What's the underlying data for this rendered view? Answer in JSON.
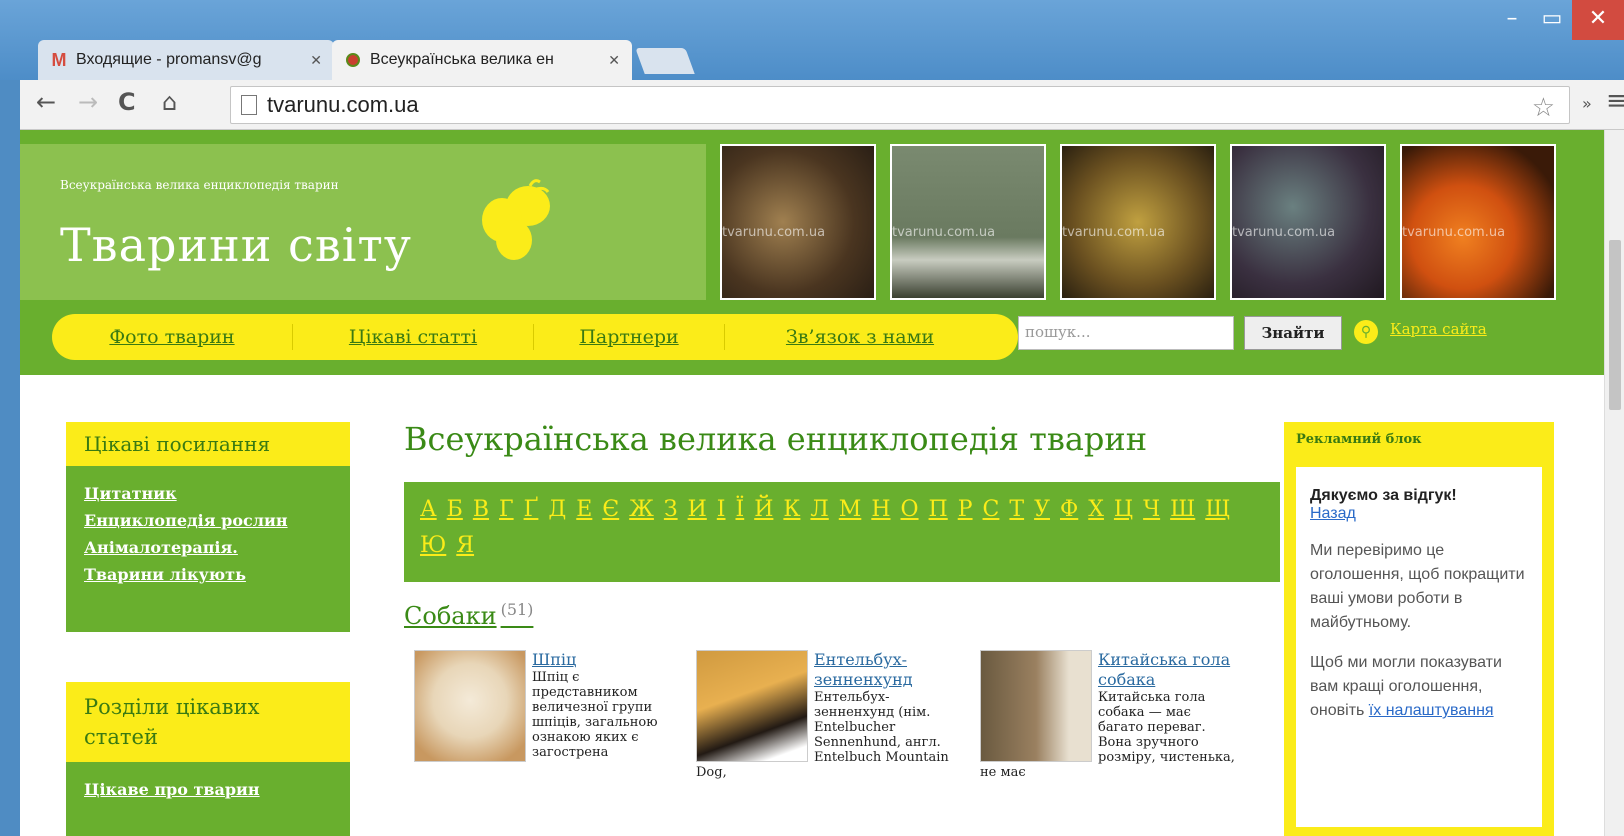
{
  "browser": {
    "tabs": [
      {
        "title": "Входящие - promansv@g",
        "active": false
      },
      {
        "title": "Всеукраїнська велика ен",
        "active": true
      }
    ],
    "url": "tvarunu.com.ua"
  },
  "site": {
    "logo_small": "Всеукраїнська велика енциклопедія тварин",
    "logo_big": "Тварини світу",
    "watermark": "tvarunu.com.ua",
    "menu": [
      "Фото тварин",
      "Цікаві статті",
      "Партнери",
      "Зв’язок з нами"
    ],
    "search_placeholder": "пошук...",
    "search_button": "Знайти",
    "sitemap": "Карта сайта"
  },
  "sidebar": {
    "block1_title": "Цікаві посилання",
    "block1_links": [
      "Цитатник",
      "Енциклопедія рослин",
      "Анімалотерапія.",
      "Тварини лікують"
    ],
    "block2_title": "Розділи цікавих статей",
    "block2_links": [
      "Цікаве про тварин"
    ]
  },
  "main": {
    "title": "Всеукраїнська велика енциклопедія тварин",
    "alphabet": [
      "А",
      "Б",
      "В",
      "Г",
      "Ґ",
      "Д",
      "Е",
      "Є",
      "Ж",
      "З",
      "И",
      "І",
      "Ї",
      "Й",
      "К",
      "Л",
      "М",
      "Н",
      "О",
      "П",
      "Р",
      "С",
      "Т",
      "У",
      "Ф",
      "Х",
      "Ц",
      "Ч",
      "Ш",
      "Щ",
      "Ю",
      "Я"
    ],
    "category": "Собаки",
    "category_count": "(51)",
    "cards": [
      {
        "name": "Шпіц",
        "text": "Шпіц є представником величезної групи шпіців, загальною ознакою яких є загострена"
      },
      {
        "name": "Ентельбух-зенненхунд",
        "text": "Ентельбух-зенненхунд (нім. Entelbucher Sennenhund, англ. Entelbuch Mountain Dog,"
      },
      {
        "name": "Китайська гола собака",
        "text": "Китайська гола собака — має багато переваг. Вона зручного розміру, чистенька, не має"
      }
    ]
  },
  "ad": {
    "head": "Рекламний блок",
    "thanks": "Дякуємо за відгук!",
    "back": "Назад",
    "text1": "Ми перевіримо це оголошення, щоб покращити ваші умови роботи в майбутньому.",
    "text2": "Щоб ми могли показувати вам кращі оголошення, оновіть",
    "link": "їх налаштування"
  }
}
